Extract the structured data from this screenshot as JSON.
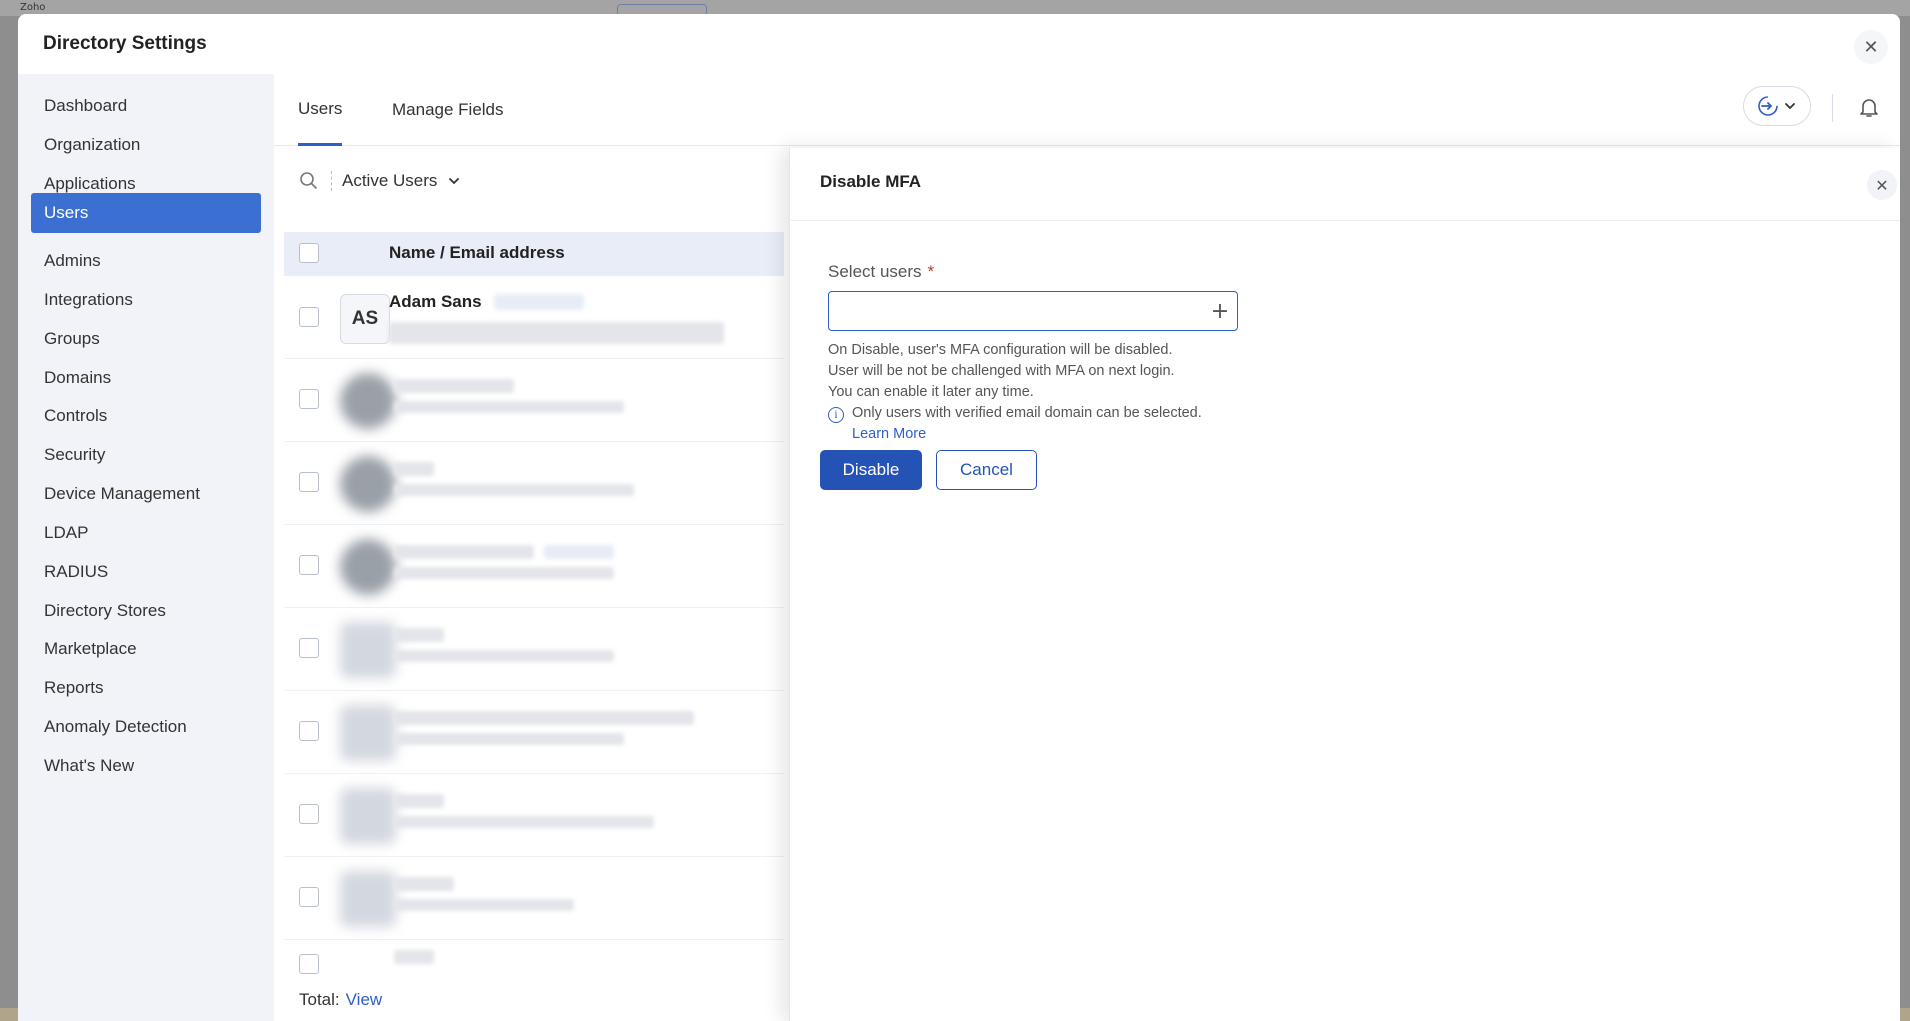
{
  "app": {
    "logo": "Zoho"
  },
  "modal": {
    "title": "Directory Settings",
    "close_icon": "close-icon"
  },
  "sidebar": {
    "items": [
      {
        "label": "Dashboard"
      },
      {
        "label": "Organization"
      },
      {
        "label": "Applications"
      },
      {
        "label": "Users",
        "active": true
      },
      {
        "label": "Admins"
      },
      {
        "label": "Integrations"
      },
      {
        "label": "Groups"
      },
      {
        "label": "Domains"
      },
      {
        "label": "Controls"
      },
      {
        "label": "Security"
      },
      {
        "label": "Device Management"
      },
      {
        "label": "LDAP"
      },
      {
        "label": "RADIUS"
      },
      {
        "label": "Directory Stores"
      },
      {
        "label": "Marketplace"
      },
      {
        "label": "Reports"
      },
      {
        "label": "Anomaly Detection"
      },
      {
        "label": "What's New"
      }
    ]
  },
  "tabs": [
    {
      "label": "Users",
      "active": true
    },
    {
      "label": "Manage Fields"
    }
  ],
  "filter": {
    "label": "Active Users"
  },
  "table": {
    "header": "Name / Email address",
    "rows": [
      {
        "initials": "AS",
        "name": "Adam Sans"
      }
    ]
  },
  "footer": {
    "total_label": "Total:",
    "view_link": "View"
  },
  "panel": {
    "title": "Disable MFA",
    "field_label": "Select users",
    "required_mark": "*",
    "help_lines": [
      "On Disable, user's MFA configuration will be disabled.",
      "User will be not be challenged with MFA on next login.",
      "You can enable it later any time."
    ],
    "info_text": "Only users with verified email domain can be selected.",
    "learn_more": "Learn More",
    "primary_button": "Disable",
    "secondary_button": "Cancel"
  },
  "colors": {
    "accent": "#2d5fc6",
    "sidebar_active": "#3b6fd1",
    "primary_button": "#2553b5"
  }
}
